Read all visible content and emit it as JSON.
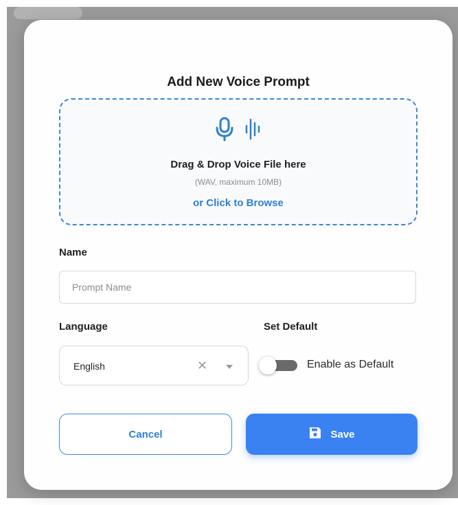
{
  "modal": {
    "title": "Add New Voice Prompt"
  },
  "dropzone": {
    "main_text": "Drag & Drop Voice File here",
    "hint_text": "(WAV, maximum 10MB)",
    "browse_link": "or Click to Browse",
    "icons": [
      "microphone-icon",
      "audio-wave-icon"
    ]
  },
  "name_field": {
    "label": "Name",
    "value": "",
    "placeholder": "Prompt Name"
  },
  "language_field": {
    "label": "Language",
    "selected": "English",
    "clear_icon": "close-icon",
    "caret_icon": "caret-down-icon"
  },
  "default_field": {
    "label": "Set Default",
    "toggle_label": "Enable as Default",
    "enabled": false
  },
  "buttons": {
    "cancel_label": "Cancel",
    "save_label": "Save",
    "save_icon": "floppy-disk-icon"
  },
  "colors": {
    "accent": "#3a82f2",
    "dropzone_border": "#3a86d8",
    "link": "#2f7fd1"
  }
}
